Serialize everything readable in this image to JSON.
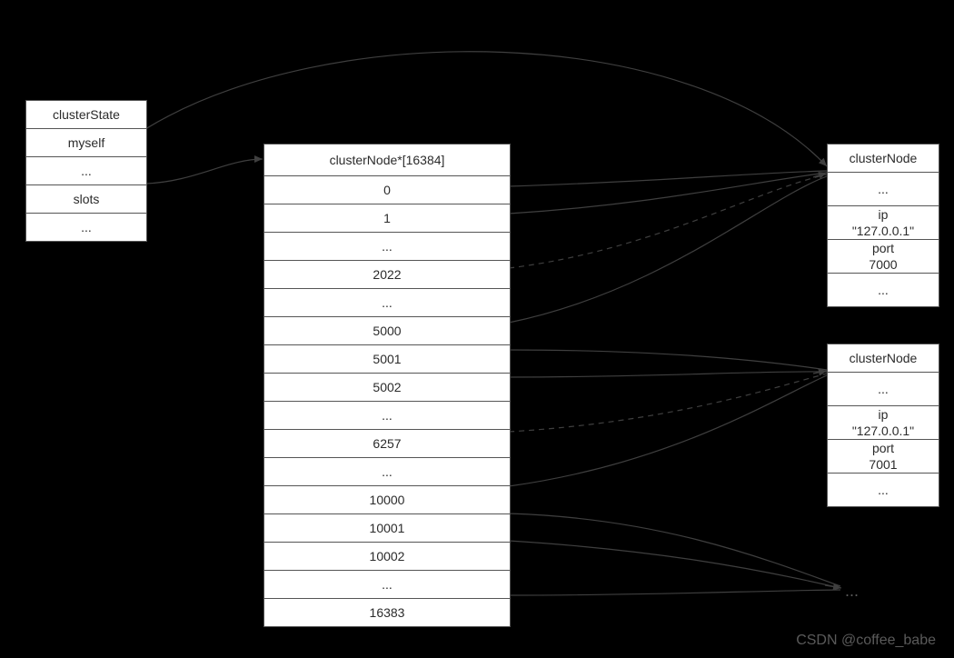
{
  "watermark": "CSDN @coffee_babe",
  "bottom_dots": "...",
  "cluster_state": {
    "title": "clusterState",
    "rows": [
      "myself",
      "...",
      "slots",
      "..."
    ]
  },
  "slot_table": {
    "title": "clusterNode*[16384]",
    "rows": [
      "0",
      "1",
      "...",
      "2022",
      "...",
      "5000",
      "5001",
      "5002",
      "...",
      "6257",
      "...",
      "10000",
      "10001",
      "10002",
      "...",
      "16383"
    ]
  },
  "node_a": {
    "title": "clusterNode",
    "rows_before": [
      "..."
    ],
    "ip_label": "ip",
    "ip_value": "\"127.0.0.1\"",
    "port_label": "port",
    "port_value": "7000",
    "rows_after": [
      "..."
    ]
  },
  "node_b": {
    "title": "clusterNode",
    "rows_before": [
      "..."
    ],
    "ip_label": "ip",
    "ip_value": "\"127.0.0.1\"",
    "port_label": "port",
    "port_value": "7001",
    "rows_after": [
      "..."
    ]
  }
}
